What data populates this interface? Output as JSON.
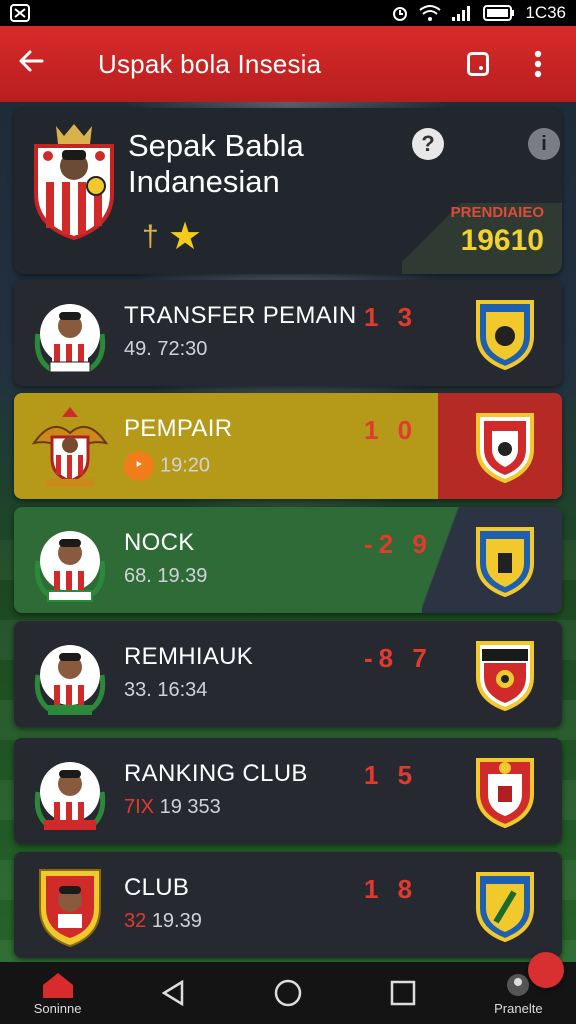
{
  "status_bar": {
    "time": "1C36"
  },
  "app_bar": {
    "title": "Uspak bola Insesia"
  },
  "header_card": {
    "title_line1": "Sepak Babla",
    "title_line2": "Indanesian",
    "help_glyph": "?",
    "info_glyph": "i",
    "pre_label": "PRENDIAIEO",
    "value": "19610"
  },
  "rows": [
    {
      "label": "TRANSFER PEMAIN",
      "sub": "49. 72:30",
      "sub_accent": "",
      "score": "1 3"
    },
    {
      "label": "PEMPAIR",
      "sub": "19:20",
      "sub_accent": "",
      "score": "1 0"
    },
    {
      "label": "NOCK",
      "sub": "68. 19.39",
      "sub_accent": "",
      "score": "-2 9"
    },
    {
      "label": "REMHIAUK",
      "sub": "33. 16:34",
      "sub_accent": "",
      "score": "-8 7"
    },
    {
      "label": "RANKING CLUB",
      "sub": "19 353",
      "sub_accent": "7IX",
      "score": "1 5"
    },
    {
      "label": "CLUB",
      "sub": "19.39",
      "sub_accent": "32",
      "score": "1 8"
    }
  ],
  "nav": {
    "home_label": "Soninne",
    "profile_label": "Pranelte"
  },
  "colors": {
    "app_bar_red": "#d82b2b",
    "score_red": "#e23a2e",
    "gold": "#f2d22e",
    "row_yellow": "#b59a1a",
    "row_green": "#2e6b36"
  },
  "icons": [
    "back-arrow-icon",
    "tablet-icon",
    "more-vert-icon",
    "help-icon",
    "info-icon",
    "star-icon",
    "home-icon",
    "back-triangle-icon",
    "circle-home-icon",
    "square-recents-icon"
  ]
}
